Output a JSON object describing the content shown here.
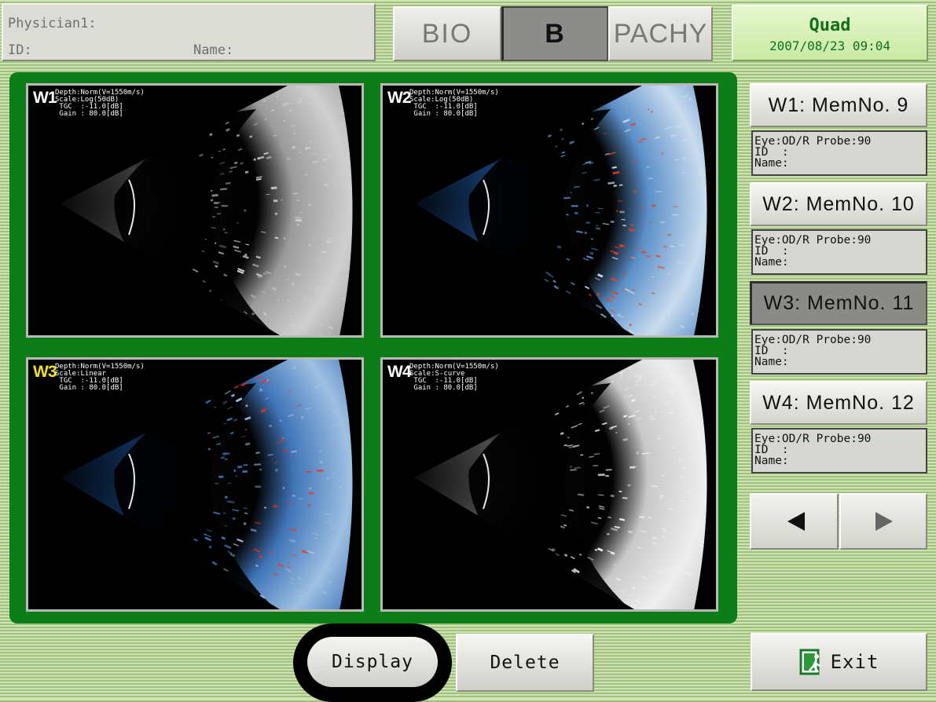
{
  "header": {
    "physician_label": "Physician1:",
    "id_label": "ID:",
    "name_label": "Name:",
    "modes": [
      "BIO",
      "B",
      "PACHY"
    ],
    "active_mode": "B",
    "display_mode": "Quad",
    "datetime": "2007/08/23 09:04"
  },
  "windows": [
    {
      "label": "W1",
      "depth": "Depth:Norm(V=1550m/s)",
      "scale": "Scale:Log(50dB)",
      "tgc": " TGC  :-11.0[dB]",
      "gain": " Gain : 80.0[dB]",
      "palette": "gray"
    },
    {
      "label": "W2",
      "depth": "Depth:Norm(V=1550m/s)",
      "scale": "Scale:Log(50dB)",
      "tgc": " TGC  :-11.0[dB]",
      "gain": " Gain : 80.0[dB]",
      "palette": "color"
    },
    {
      "label": "W3",
      "depth": "Depth:Norm(V=1550m/s)",
      "scale": "Scale:Linear",
      "tgc": " TGC  :-11.0[dB]",
      "gain": " Gain : 80.0[dB]",
      "palette": "color-strong",
      "selected": true
    },
    {
      "label": "W4",
      "depth": "Depth:Norm(V=1550m/s)",
      "scale": "Scale:S-curve",
      "tgc": " TGC  :-11.0[dB]",
      "gain": " Gain : 80.0[dB]",
      "palette": "gray-bright"
    }
  ],
  "memory": [
    {
      "title": "W1: MemNo. 9",
      "eye": "Eye:OD/R Probe:90",
      "id": "ID  :",
      "name": "Name:"
    },
    {
      "title": "W2: MemNo. 10",
      "eye": "Eye:OD/R Probe:90",
      "id": "ID  :",
      "name": "Name:"
    },
    {
      "title": "W3: MemNo. 11",
      "eye": "Eye:OD/R Probe:90",
      "id": "ID  :",
      "name": "Name:",
      "selected": true
    },
    {
      "title": "W4: MemNo. 12",
      "eye": "Eye:OD/R Probe:90",
      "id": "ID  :",
      "name": "Name:"
    }
  ],
  "nav": {
    "prev_icon": "triangle-left-icon",
    "next_icon": "triangle-right-icon"
  },
  "buttons": {
    "display": "Display",
    "delete": "Delete",
    "exit": "Exit",
    "exit_icon": "exit-door-icon"
  },
  "colors": {
    "panel_green": "#0c7d18",
    "title_green": "#0f6f1f",
    "selected_label": "#f2e020",
    "selected_gray": "#8a8a86"
  }
}
